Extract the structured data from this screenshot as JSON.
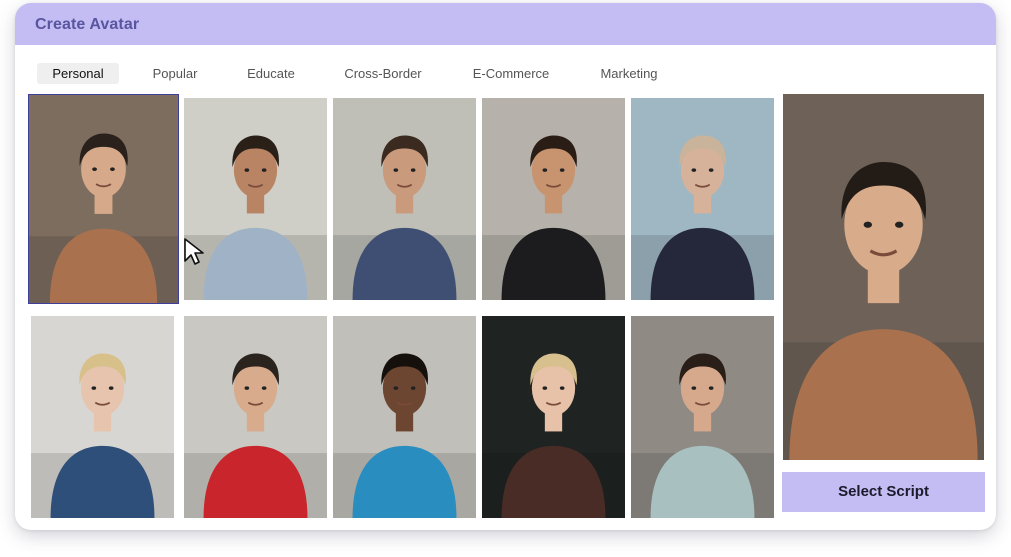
{
  "header": {
    "title": "Create Avatar"
  },
  "tabs": [
    {
      "label": "Personal",
      "active": true
    },
    {
      "label": "Popular",
      "active": false
    },
    {
      "label": "Educate",
      "active": false
    },
    {
      "label": "Cross-Border",
      "active": false
    },
    {
      "label": "E-Commerce",
      "active": false
    },
    {
      "label": "Marketing",
      "active": false
    }
  ],
  "avatars": [
    {
      "bg": "#7d6d5f",
      "skin": "#d6a98a",
      "hair": "#2a211c",
      "top": "#a9714e",
      "selected": true
    },
    {
      "bg": "#cfcfc7",
      "skin": "#b98463",
      "hair": "#2b2018",
      "top": "#9fb2c6",
      "selected": false
    },
    {
      "bg": "#bfbfb8",
      "skin": "#c99a7b",
      "hair": "#3a2a1f",
      "top": "#3f4f74",
      "selected": false
    },
    {
      "bg": "#b6b2ab",
      "skin": "#c8946f",
      "hair": "#2a1d16",
      "top": "#1c1c1e",
      "selected": false
    },
    {
      "bg": "#9fb7c2",
      "skin": "#d7b29b",
      "hair": "#c9b39b",
      "top": "#24283a",
      "selected": false
    },
    {
      "bg": "#d8d6d2",
      "skin": "#e6c4ad",
      "hair": "#d8c08a",
      "top": "#2d4f7a",
      "selected": false
    },
    {
      "bg": "#c9c8c2",
      "skin": "#d7ab8b",
      "hair": "#2b231d",
      "top": "#c8262c",
      "selected": false
    },
    {
      "bg": "#c0bfb9",
      "skin": "#6d4632",
      "hair": "#16100c",
      "top": "#2a8dc0",
      "selected": false
    },
    {
      "bg": "#1f2422",
      "skin": "#e7c2a8",
      "hair": "#d7c08e",
      "top": "#4a2c26",
      "selected": false
    },
    {
      "bg": "#8f8a84",
      "skin": "#d6a98d",
      "hair": "#2a1f18",
      "top": "#a8c0c0",
      "selected": false
    }
  ],
  "preview": {
    "bg": "#6e6258",
    "skin": "#d8ab8b",
    "hair": "#231b16",
    "top": "#a9714e"
  },
  "cta": {
    "label": "Select Script"
  }
}
